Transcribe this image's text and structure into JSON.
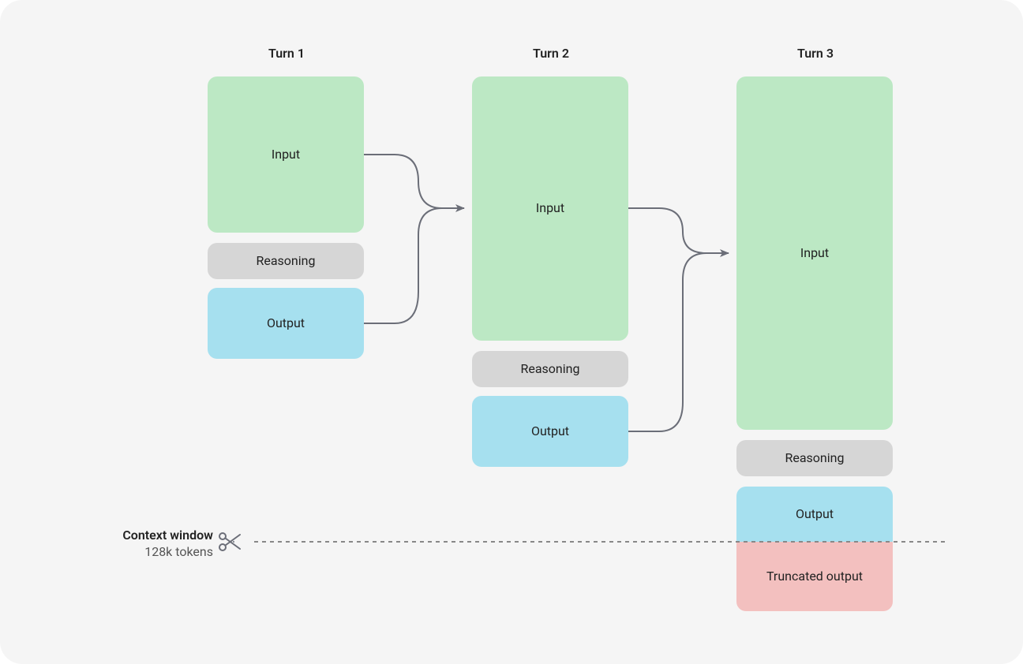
{
  "columns": {
    "turn1": {
      "header": "Turn 1"
    },
    "turn2": {
      "header": "Turn 2"
    },
    "turn3": {
      "header": "Turn 3"
    }
  },
  "labels": {
    "input": "Input",
    "reasoning": "Reasoning",
    "output": "Output",
    "truncated": "Truncated output"
  },
  "context": {
    "title": "Context window",
    "subtitle": "128k tokens"
  },
  "colors": {
    "input": "#bce8c4",
    "reasoning": "#d6d6d6",
    "output": "#a6e0ef",
    "truncated": "#f3c0bf",
    "frameBg": "#f5f5f5",
    "arrow": "#6b6e78",
    "dash": "#888888"
  },
  "diagram_description": "Three conversation turns. Each turn's input block grows because it absorbs the prior turn's input and output. A dashed context-window line at 128k tokens cuts through Turn 3's output, producing a truncated-output block below the line. Arrows show Turn 1 input and output flowing into Turn 2 input, and Turn 2 input and output flowing into Turn 3 input."
}
